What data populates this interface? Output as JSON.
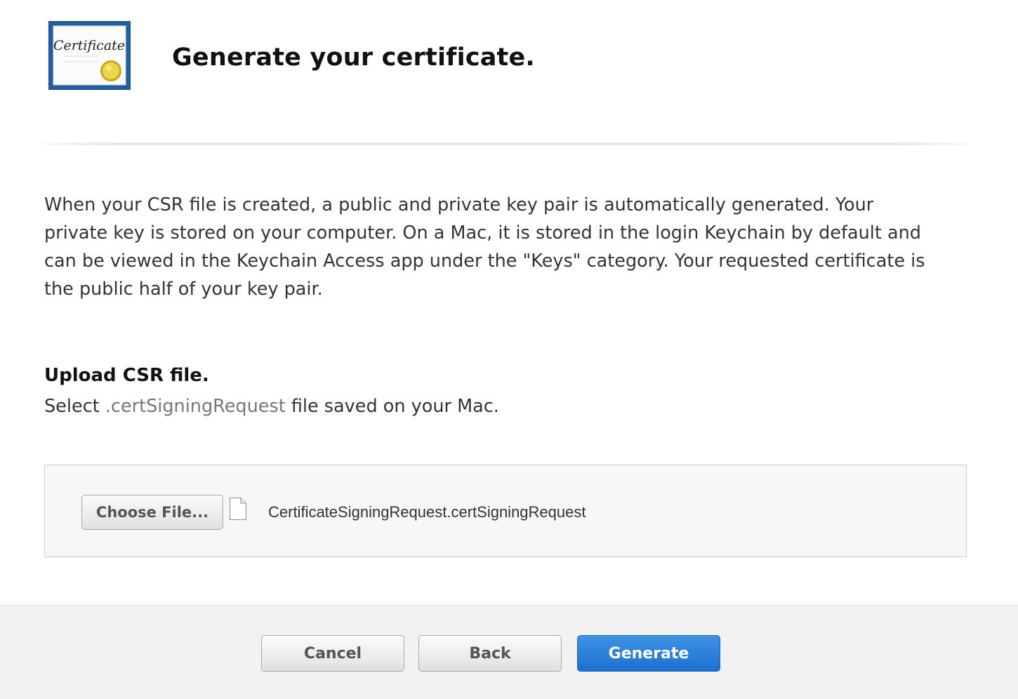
{
  "header": {
    "title": "Generate your certificate.",
    "icon": {
      "name": "certificate-icon",
      "text": "Certificate"
    }
  },
  "description": "When your CSR file is created, a public and private key pair is automatically generated. Your private key is stored on your computer. On a Mac, it is stored in the login Keychain by default and can be viewed in the Keychain Access app under the \"Keys\" category. Your requested certificate is the public half of your key pair.",
  "upload": {
    "heading": "Upload CSR file.",
    "instruction_prefix": "Select",
    "instruction_ext": ".certSigningRequest",
    "instruction_suffix": "file saved on your Mac.",
    "choose_file_label": "Choose File...",
    "file_icon": "document-icon",
    "file_name": "CertificateSigningRequest.certSigningRequest"
  },
  "footer": {
    "cancel_label": "Cancel",
    "back_label": "Back",
    "generate_label": "Generate"
  },
  "colors": {
    "primary_button": "#2a7fd8",
    "footer_background": "#f2f2f2",
    "upload_box_background": "#f6f7f7",
    "certificate_frame": "#1f5fa3",
    "seal_gold": "#e8c83a"
  }
}
